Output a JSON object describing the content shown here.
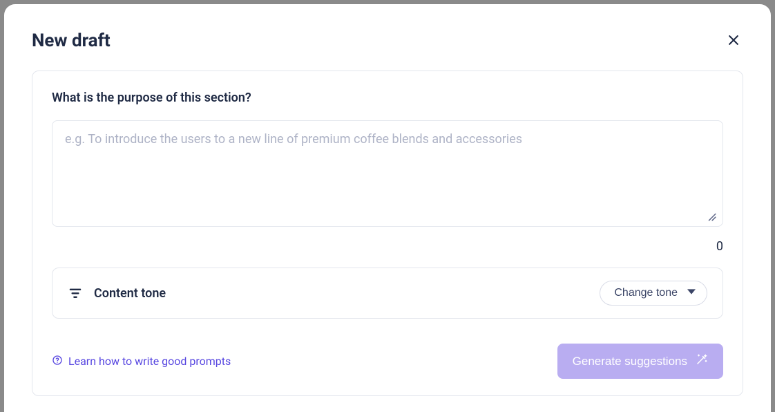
{
  "modal": {
    "title": "New draft"
  },
  "prompt": {
    "question": "What is the purpose of this section?",
    "placeholder": "e.g. To introduce the users to a new line of premium coffee blends and accessories",
    "value": "",
    "char_count": "0"
  },
  "tone": {
    "label": "Content tone",
    "select_label": "Change tone"
  },
  "footer": {
    "help_text": "Learn how to write good prompts",
    "generate_label": "Generate suggestions"
  }
}
